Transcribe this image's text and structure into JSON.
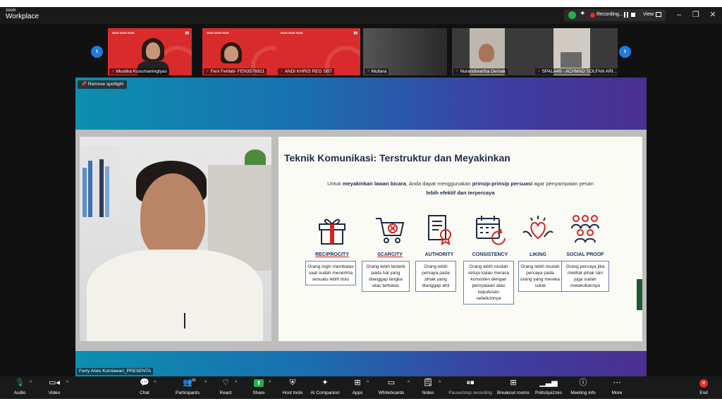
{
  "app": {
    "brand_small": "zoom",
    "brand_name": "Workplace",
    "recording_label": "Recording...",
    "view_label": "View",
    "colors": {
      "accent": "#1f7ae0",
      "recording": "#e32b2b",
      "secure": "#21b24b",
      "end": "#e32b2b"
    }
  },
  "gallery": {
    "tiles": [
      {
        "name": "Mustika Kusumaningtyas"
      },
      {
        "name": "Feni Fertiati- FEN3576921"
      },
      {
        "name": "ANDI KHRIS REG SBT"
      },
      {
        "name": "Mutiara"
      },
      {
        "name": "Nurandreartha Demak"
      },
      {
        "name": "SPALA49 - ACHMAD SOLFAN ARI..."
      }
    ]
  },
  "spotlight": {
    "remove_label": "Remove spotlight",
    "presenter_name": "Ferry Aries Kurniawan_PRESENTA"
  },
  "slide": {
    "title": "Teknik Komunikasi: Terstruktur dan Meyakinkan",
    "sub_part1": "Untuk ",
    "sub_bold1": "meyakinkan lawan bicara",
    "sub_part2": ", Anda dapat menggunakan ",
    "sub_bold2": "prinsip-prinsip persuasi",
    "sub_part3": " agar penyampaian pesan",
    "sub_line2": "lebih efektif dan terpercaya",
    "principles": [
      {
        "label": "RECIPROCITY",
        "desc": "Orang ingin membalas saat sudah menerima sesuatu lebih dulu",
        "icon": "gift-icon"
      },
      {
        "label": "SCARCITY",
        "desc": "Orang lebih tertarik pada hal yang dianggap langka atau terbatas",
        "icon": "cart-icon"
      },
      {
        "label": "AUTHORITY",
        "desc": "Orang lebih percaya pada pihak yang dianggap ahli",
        "icon": "certificate-icon"
      },
      {
        "label": "CONSISTENCY",
        "desc": "Orang lebih mudah setuju kalau merasa konsisten dengan pernyataan atau keputusan sebelumnya",
        "icon": "calendar-icon"
      },
      {
        "label": "LIKING",
        "desc": "Orang lebih mudah percaya pada orang yang mereka sukai",
        "icon": "heart-hands-icon"
      },
      {
        "label": "SOCIAL PROOF",
        "desc": "Orang percaya jika melihat pihak lain juga sudah melakukannya",
        "icon": "people-icon"
      }
    ]
  },
  "toolbar": {
    "audio": "Audio",
    "video": "Video",
    "chat": "Chat",
    "participants": "Participants",
    "participants_count": "90",
    "react": "React",
    "share": "Share",
    "host_tools": "Host tools",
    "ai_companion": "AI Companion",
    "apps": "Apps",
    "whiteboards": "Whiteboards",
    "notes": "Notes",
    "pause_recording": "Pause/stop recording",
    "breakout_rooms": "Breakout rooms",
    "polls": "Polls/quizzes",
    "meeting_info": "Meeting info",
    "more": "More",
    "end": "End"
  }
}
